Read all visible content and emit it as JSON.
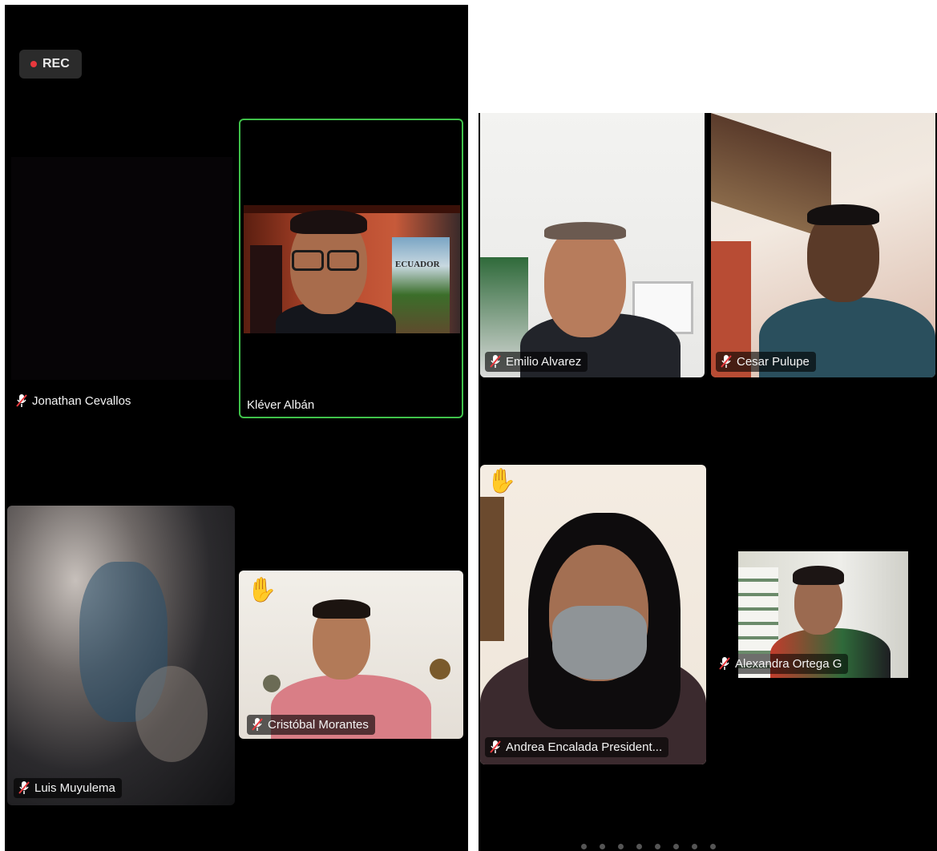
{
  "recording": {
    "label": "REC"
  },
  "participants": {
    "jonathan": {
      "name": "Jonathan Cevallos"
    },
    "klever": {
      "name": "Kléver Albán"
    },
    "luis": {
      "name": "Luis Muyulema"
    },
    "cristobal": {
      "name": "Cristóbal Morantes"
    },
    "emilio": {
      "name": "Emilio Alvarez"
    },
    "cesar": {
      "name": "Cesar Pulupe"
    },
    "andrea": {
      "name": "Andrea Encalada President..."
    },
    "alexandra": {
      "name": "Alexandra Ortega G"
    }
  },
  "poster": {
    "text": "ECUADOR"
  },
  "colors": {
    "active_speaker_border": "#3fc24a",
    "rec_dot": "#e8383d",
    "panel_bg": "#000000",
    "raised_hand": "#f5c23a"
  },
  "icons": {
    "muted": "mic-muted-icon",
    "raised_hand": "raised-hand-icon"
  }
}
